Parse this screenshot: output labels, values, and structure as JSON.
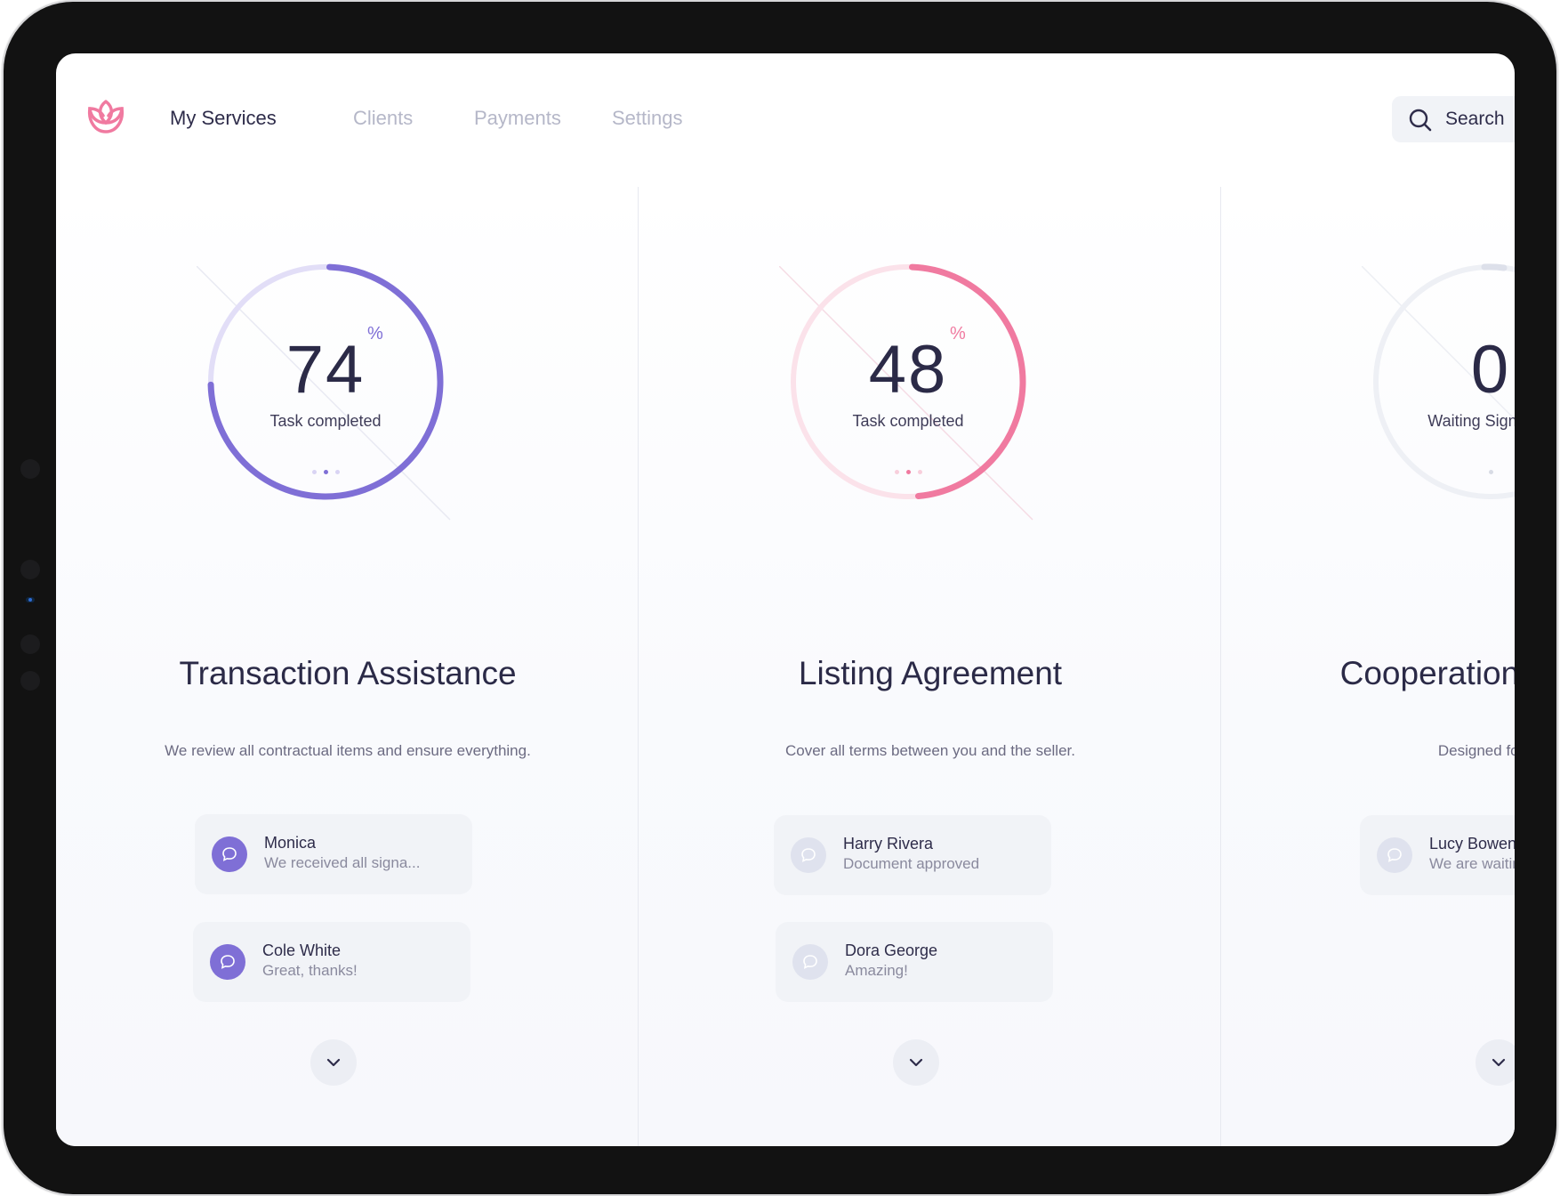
{
  "nav": {
    "brand_icon": "lotus-icon",
    "items": [
      {
        "label": "My Services",
        "active": true
      },
      {
        "label": "Clients",
        "active": false
      },
      {
        "label": "Payments",
        "active": false
      },
      {
        "label": "Settings",
        "active": false
      }
    ],
    "search_label": "Search"
  },
  "colors": {
    "accent_purple": "#7f6fd6",
    "accent_pink": "#f07aa0",
    "text_dark": "#2b2a47",
    "muted": "#b5b7c8",
    "card_bg": "#f1f3f7"
  },
  "services": [
    {
      "percent": "74",
      "percent_symbol": "%",
      "progress": 0.74,
      "label": "Task completed",
      "title": "Transaction Assistance",
      "description": "We review all contractual items and ensure everything.",
      "messages": [
        {
          "name": "Monica",
          "text": "We received all signa..."
        },
        {
          "name": "Cole White",
          "text": "Great, thanks!"
        }
      ]
    },
    {
      "percent": "48",
      "percent_symbol": "%",
      "progress": 0.48,
      "label": "Task completed",
      "title": "Listing Agreement",
      "description": "Cover all terms between you and the seller.",
      "messages": [
        {
          "name": "Harry Rivera",
          "text": "Document approved"
        },
        {
          "name": "Dora George",
          "text": "Amazing!"
        }
      ]
    },
    {
      "percent": "0",
      "label": "Waiting Signature",
      "title": "Cooperation Assistance",
      "description": "Designed for the other",
      "messages": [
        {
          "name": "Lucy Bowen",
          "text": "We are waiting"
        }
      ]
    }
  ]
}
